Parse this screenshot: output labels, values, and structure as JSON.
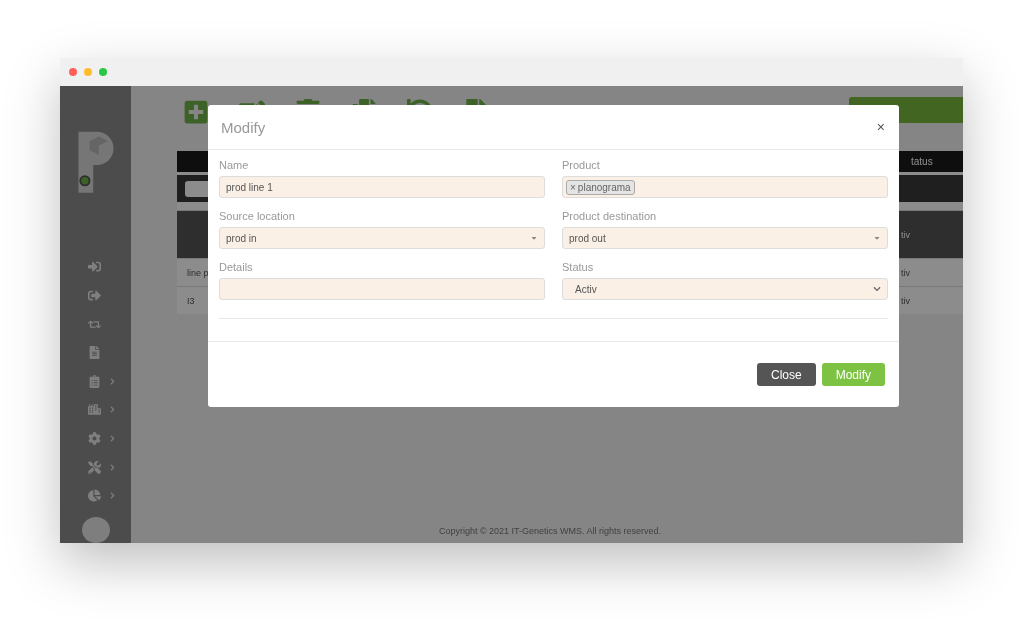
{
  "window": {
    "controls": [
      {
        "color": "#ff5f57"
      },
      {
        "color": "#febc2e"
      },
      {
        "color": "#28c840"
      }
    ]
  },
  "sidebar": {
    "items": [
      {
        "expandable": false
      },
      {
        "expandable": false
      },
      {
        "expandable": false
      },
      {
        "expandable": false
      },
      {
        "expandable": true
      },
      {
        "expandable": true
      },
      {
        "expandable": true
      },
      {
        "expandable": true
      },
      {
        "expandable": true
      }
    ]
  },
  "table": {
    "header_last": "tatus",
    "rows": [
      {
        "first": "",
        "last": "tiv",
        "selected": true
      },
      {
        "first": "line p",
        "last": "tiv",
        "selected": false
      },
      {
        "first": "I3",
        "last": "tiv",
        "selected": false
      }
    ]
  },
  "footer": "Copyright © 2021 IT-Genetics WMS. All rights reserved.",
  "modal": {
    "title": "Modify",
    "close": "×",
    "fields": [
      {
        "label": "Name",
        "kind": "text",
        "value": "prod line 1"
      },
      {
        "label": "Product",
        "kind": "tags",
        "tags": [
          {
            "remove": "×",
            "text": "planograma"
          }
        ]
      },
      {
        "label": "Source location",
        "kind": "combo",
        "value": "prod in"
      },
      {
        "label": "Product destination",
        "kind": "combo",
        "value": "prod out"
      },
      {
        "label": "Details",
        "kind": "text"
      },
      {
        "label": "Status",
        "kind": "select",
        "value": "Activ"
      }
    ],
    "buttons": [
      {
        "label": "Close",
        "kind": "secondary"
      },
      {
        "label": "Modify",
        "kind": "primary"
      }
    ]
  }
}
